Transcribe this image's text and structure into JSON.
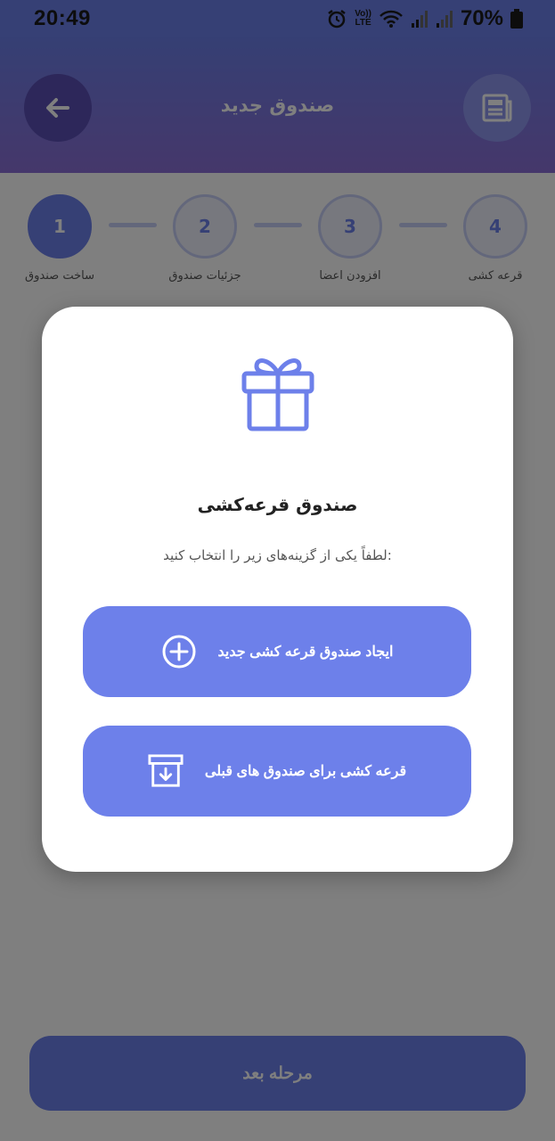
{
  "status_bar": {
    "time": "20:49",
    "battery": "70%",
    "volte_top": "Vo))",
    "volte_bottom": "LTE",
    "icons": [
      "alarm-icon",
      "volte-icon",
      "wifi-icon",
      "signal-icon",
      "signal-icon",
      "battery-icon"
    ]
  },
  "header": {
    "title": "صندوق جدید",
    "back_icon": "arrow-left-icon",
    "doc_icon": "newspaper-icon"
  },
  "stepper": {
    "steps": [
      {
        "number": "1",
        "label": "ساخت صندوق"
      },
      {
        "number": "2",
        "label": "جزئیات صندوق"
      },
      {
        "number": "3",
        "label": "افزودن اعضا"
      },
      {
        "number": "4",
        "label": "قرعه کشی"
      }
    ],
    "active_step": 1
  },
  "footer": {
    "next_label": "مرحله بعد"
  },
  "modal": {
    "icon": "gift-icon",
    "title": "صندوق قرعه‌کشی",
    "subtitle": "لطفاً یکی از گزینه‌های زیر را انتخاب کنید:",
    "options": [
      {
        "label": "ایجاد صندوق قرعه کشی جدید",
        "icon": "plus-circle-icon"
      },
      {
        "label": "قرعه کشی برای صندوق های قبلی",
        "icon": "archive-download-icon"
      }
    ]
  },
  "colors": {
    "accent": "#6d80ea",
    "header_gradient_end": "#8b6fd6",
    "overlay": "rgba(0,0,0,0.5)"
  }
}
